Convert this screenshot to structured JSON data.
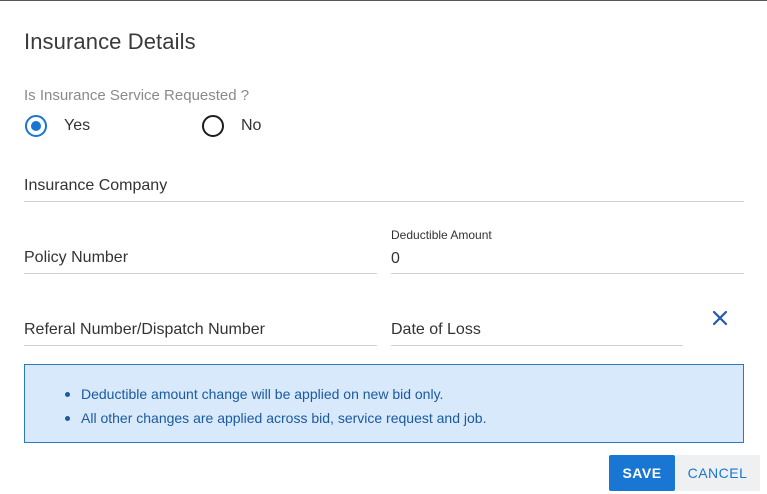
{
  "dialog": {
    "title": "Insurance Details"
  },
  "insurance_requested": {
    "question": "Is Insurance Service Requested ?",
    "options": [
      {
        "label": "Yes",
        "selected": true
      },
      {
        "label": "No",
        "selected": false
      }
    ]
  },
  "fields": {
    "insurance_company": {
      "placeholder": "Insurance Company",
      "value": ""
    },
    "policy_number": {
      "placeholder": "Policy Number",
      "value": ""
    },
    "deductible_amount": {
      "label": "Deductible Amount",
      "value": "0"
    },
    "referal_number": {
      "placeholder": "Referal Number/Dispatch Number",
      "value": ""
    },
    "date_of_loss": {
      "placeholder": "Date of Loss",
      "value": ""
    }
  },
  "clear_icon": "close-icon",
  "info": {
    "items": [
      "Deductible amount change will be applied on new bid only.",
      "All other changes are applied across bid, service request and job."
    ]
  },
  "actions": {
    "save_label": "SAVE",
    "cancel_label": "CANCEL"
  },
  "colors": {
    "primary": "#1976d2",
    "info_bg": "#d7e9fb",
    "info_border": "#2a7ac0",
    "info_text": "#1c5aa0"
  }
}
